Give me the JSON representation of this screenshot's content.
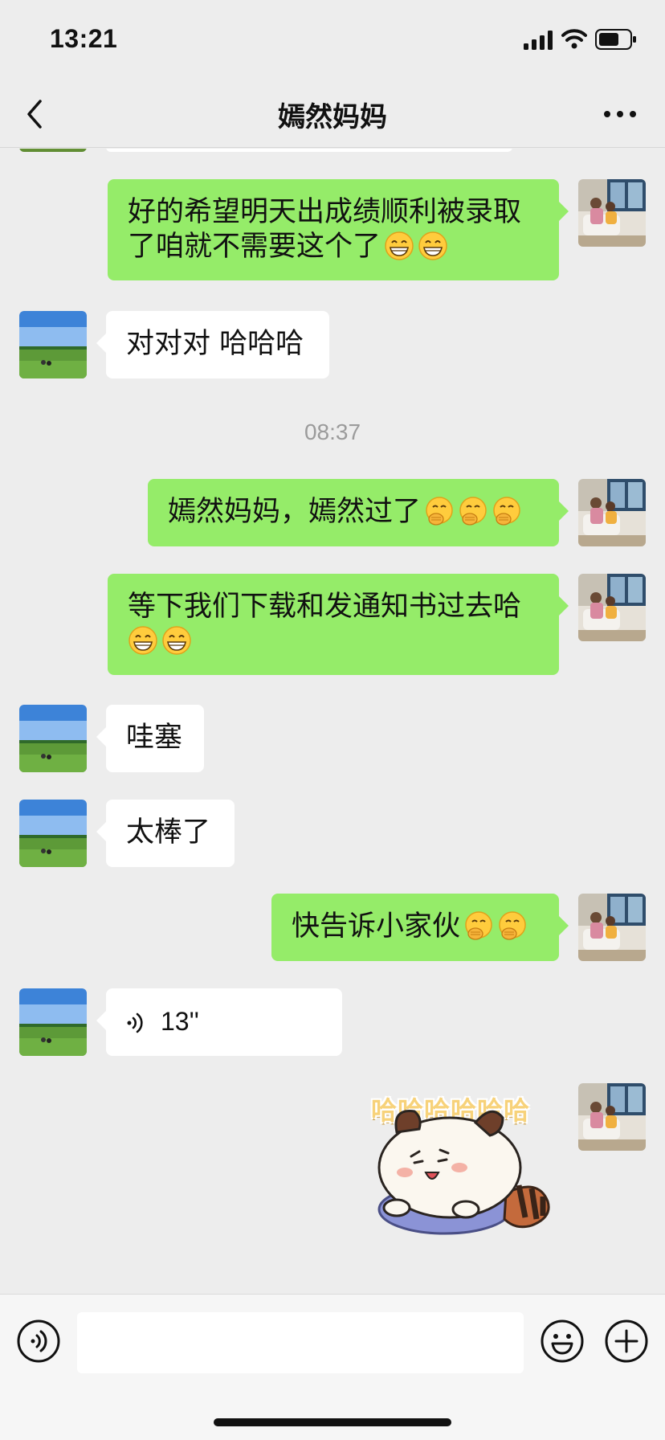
{
  "status_bar": {
    "time": "13:21"
  },
  "header": {
    "title": "嫣然妈妈"
  },
  "messages": [
    {
      "side": "out",
      "text": "好的希望明天出成绩顺利被录取了咱就不需要这个了",
      "line1": "好的希望明天出成绩顺利被录取",
      "line2": "了咱就不需要这个了",
      "emojis": [
        "grin-emoji",
        "grin-emoji"
      ]
    },
    {
      "side": "in",
      "text": "对对对 哈哈哈"
    },
    {
      "side": "out",
      "text": "嫣然妈妈，嫣然过了",
      "emojis": [
        "hand-over-mouth-emoji",
        "hand-over-mouth-emoji",
        "hand-over-mouth-emoji"
      ]
    },
    {
      "side": "out",
      "text": "等下我们下载和发通知书过去哈",
      "emojis": [
        "grin-emoji",
        "grin-emoji"
      ]
    },
    {
      "side": "in",
      "text": "哇塞"
    },
    {
      "side": "in",
      "text": "太棒了"
    },
    {
      "side": "out",
      "text": "快告诉小家伙",
      "emojis": [
        "hand-over-mouth-emoji",
        "hand-over-mouth-emoji"
      ]
    },
    {
      "side": "in",
      "type": "voice",
      "duration": "13''"
    },
    {
      "side": "out",
      "type": "sticker",
      "sticker_text": "哈哈哈哈哈哈",
      "icon": "raccoon-sticker"
    }
  ],
  "timestamp": "08:37",
  "input": {
    "placeholder": ""
  },
  "icons": {
    "back": "chevron-left-icon",
    "more": "more-dots-icon",
    "voice": "voice-mode-icon",
    "emoji": "emoji-icon",
    "plus": "plus-icon"
  },
  "colors": {
    "outgoing_bubble": "#95ec69",
    "incoming_bubble": "#ffffff",
    "background": "#ededed"
  }
}
